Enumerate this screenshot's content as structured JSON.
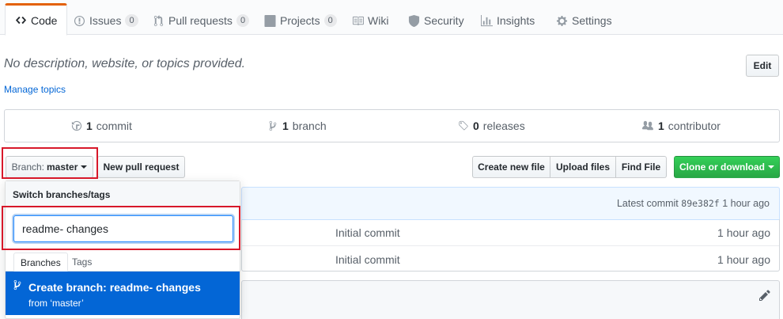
{
  "tabs": [
    {
      "label": "Code",
      "icon": "code-icon"
    },
    {
      "label": "Issues",
      "count": "0",
      "icon": "issue-icon"
    },
    {
      "label": "Pull requests",
      "count": "0",
      "icon": "pull-request-icon"
    },
    {
      "label": "Projects",
      "count": "0",
      "icon": "project-icon"
    },
    {
      "label": "Wiki",
      "icon": "book-icon"
    },
    {
      "label": "Security",
      "icon": "shield-icon"
    },
    {
      "label": "Insights",
      "icon": "graph-icon"
    },
    {
      "label": "Settings",
      "icon": "gear-icon"
    }
  ],
  "repo": {
    "description": "No description, website, or topics provided.",
    "manage_topics": "Manage topics",
    "edit_label": "Edit"
  },
  "numbers": {
    "commits_count": "1",
    "commits_label": "commit",
    "branches_count": "1",
    "branches_label": "branch",
    "releases_count": "0",
    "releases_label": "releases",
    "contributors_count": "1",
    "contributors_label": "contributor"
  },
  "toolbar": {
    "branch_prefix": "Branch:",
    "branch_name": "master",
    "new_pr": "New pull request",
    "create_file": "Create new file",
    "upload_files": "Upload files",
    "find_file": "Find File",
    "clone": "Clone or download"
  },
  "commit": {
    "latest_label": "Latest commit",
    "sha": "89e382f",
    "age": "1 hour ago"
  },
  "files": [
    {
      "message": "Initial commit",
      "age": "1 hour ago"
    },
    {
      "message": "Initial commit",
      "age": "1 hour ago"
    }
  ],
  "branch_dropdown": {
    "header": "Switch branches/tags",
    "input_value": "readme- changes",
    "tab_branches": "Branches",
    "tab_tags": "Tags",
    "create_title": "Create branch: readme- changes",
    "create_from": "from ‘master’"
  },
  "colors": {
    "accent": "#0366d6",
    "highlight": "#d7182a",
    "clone_green": "#28a745"
  }
}
